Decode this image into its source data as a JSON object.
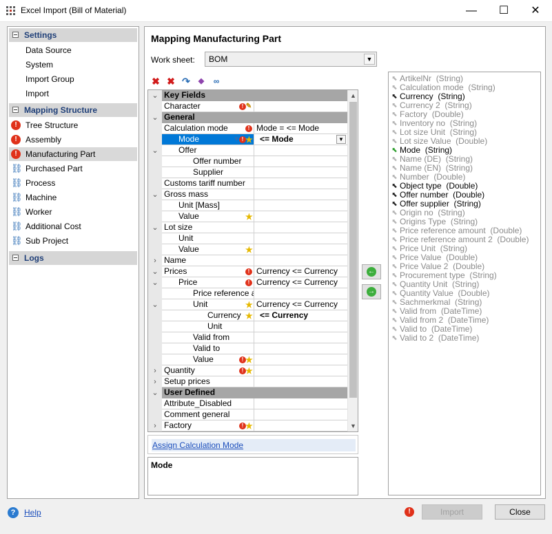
{
  "window": {
    "title": "Excel Import (Bill of Material)",
    "minimize": "—",
    "maximize": "☐",
    "close": "✕"
  },
  "sidebar": {
    "settings_header": "Settings",
    "settings_items": [
      "Data Source",
      "System",
      "Import Group",
      "Import"
    ],
    "mapping_header": "Mapping Structure",
    "mapping_items": [
      {
        "label": "Tree Structure",
        "icon": "error-icon"
      },
      {
        "label": "Assembly",
        "icon": "error-icon"
      },
      {
        "label": "Manufacturing Part",
        "icon": "error-icon",
        "selected": true
      },
      {
        "label": "Purchased Part",
        "icon": "network-icon"
      },
      {
        "label": "Process",
        "icon": "network-icon"
      },
      {
        "label": "Machine",
        "icon": "network-icon"
      },
      {
        "label": "Worker",
        "icon": "network-icon"
      },
      {
        "label": "Additional Cost",
        "icon": "network-icon"
      },
      {
        "label": "Sub Project",
        "icon": "network-icon"
      }
    ],
    "logs_header": "Logs"
  },
  "main": {
    "title": "Mapping Manufacturing Part",
    "worksheet_label": "Work sheet:",
    "worksheet_value": "BOM",
    "grid_rows": [
      {
        "label": "Key Fields",
        "group": true
      },
      {
        "label": "Character",
        "value": ""
      },
      {
        "label": "General",
        "group": true
      },
      {
        "label": "Calculation mode",
        "value": "Mode =  <= Mode"
      },
      {
        "label": "Mode",
        "value": "<= Mode",
        "selected": true
      },
      {
        "label": "Offer",
        "value": ""
      },
      {
        "label": "Offer number",
        "value": ""
      },
      {
        "label": "Supplier",
        "value": ""
      },
      {
        "label": "Customs tariff number",
        "value": ""
      },
      {
        "label": "Gross mass",
        "value": ""
      },
      {
        "label": "Unit  [Mass]",
        "value": ""
      },
      {
        "label": "Value",
        "value": ""
      },
      {
        "label": "Lot size",
        "value": ""
      },
      {
        "label": "Unit",
        "value": ""
      },
      {
        "label": "Value",
        "value": ""
      },
      {
        "label": "Name",
        "value": ""
      },
      {
        "label": "Prices",
        "value": "Currency <= Currency"
      },
      {
        "label": "Price",
        "value": "Currency <= Currency"
      },
      {
        "label": "Price reference amount",
        "value": ""
      },
      {
        "label": "Unit",
        "value": "Currency <= Currency"
      },
      {
        "label": "Currency",
        "value": "<= Currency"
      },
      {
        "label": "Unit",
        "value": ""
      },
      {
        "label": "Valid from",
        "value": ""
      },
      {
        "label": "Valid to",
        "value": ""
      },
      {
        "label": "Value",
        "value": ""
      },
      {
        "label": "Quantity",
        "value": ""
      },
      {
        "label": "Setup prices",
        "value": ""
      },
      {
        "label": "User Defined",
        "group": true
      },
      {
        "label": "Attribute_Disabled",
        "value": ""
      },
      {
        "label": "Comment general",
        "value": ""
      },
      {
        "label": "Factory",
        "value": ""
      }
    ],
    "link_text": "Assign Calculation Mode",
    "description_title": "Mode"
  },
  "fields": [
    {
      "name": "ArtikelNr",
      "type": "(String)",
      "bold": false
    },
    {
      "name": "Calculation mode",
      "type": "(String)",
      "bold": false
    },
    {
      "name": "Currency",
      "type": "(String)",
      "bold": true
    },
    {
      "name": "Currency 2",
      "type": "(String)",
      "bold": false
    },
    {
      "name": "Factory",
      "type": "(Double)",
      "bold": false
    },
    {
      "name": "Inventory no",
      "type": "(String)",
      "bold": false
    },
    {
      "name": "Lot size Unit",
      "type": "(String)",
      "bold": false
    },
    {
      "name": "Lot size Value",
      "type": "(Double)",
      "bold": false
    },
    {
      "name": "Mode",
      "type": "(String)",
      "bold": true,
      "green": true
    },
    {
      "name": "Name (DE)",
      "type": "(String)",
      "bold": false
    },
    {
      "name": "Name (EN)",
      "type": "(String)",
      "bold": false
    },
    {
      "name": "Number",
      "type": "(Double)",
      "bold": false
    },
    {
      "name": "Object type",
      "type": "(Double)",
      "bold": true
    },
    {
      "name": "Offer number",
      "type": "(Double)",
      "bold": true
    },
    {
      "name": "Offer supplier",
      "type": "(String)",
      "bold": true
    },
    {
      "name": "Origin no",
      "type": "(String)",
      "bold": false
    },
    {
      "name": "Origins Type",
      "type": "(String)",
      "bold": false
    },
    {
      "name": "Price reference amount",
      "type": "(Double)",
      "bold": false
    },
    {
      "name": "Price reference amount 2",
      "type": "(Double)",
      "bold": false
    },
    {
      "name": "Price Unit",
      "type": "(String)",
      "bold": false
    },
    {
      "name": "Price Value",
      "type": "(Double)",
      "bold": false
    },
    {
      "name": "Price Value 2",
      "type": "(Double)",
      "bold": false
    },
    {
      "name": "Procurement type",
      "type": "(String)",
      "bold": false
    },
    {
      "name": "Quantity Unit",
      "type": "(String)",
      "bold": false
    },
    {
      "name": "Quantity Value",
      "type": "(Double)",
      "bold": false
    },
    {
      "name": "Sachmerkmal",
      "type": "(String)",
      "bold": false
    },
    {
      "name": "Valid from",
      "type": "(DateTime)",
      "bold": false
    },
    {
      "name": "Valid from 2",
      "type": "(DateTime)",
      "bold": false
    },
    {
      "name": "Valid to",
      "type": "(DateTime)",
      "bold": false
    },
    {
      "name": "Valid to 2",
      "type": "(DateTime)",
      "bold": false
    }
  ],
  "footer": {
    "help_label": "Help",
    "import_label": "Import",
    "close_label": "Close"
  },
  "colors": {
    "accent": "#0078d7",
    "error": "#e0311a",
    "group_row": "#a6a6a6",
    "link": "#1a4dbb"
  }
}
